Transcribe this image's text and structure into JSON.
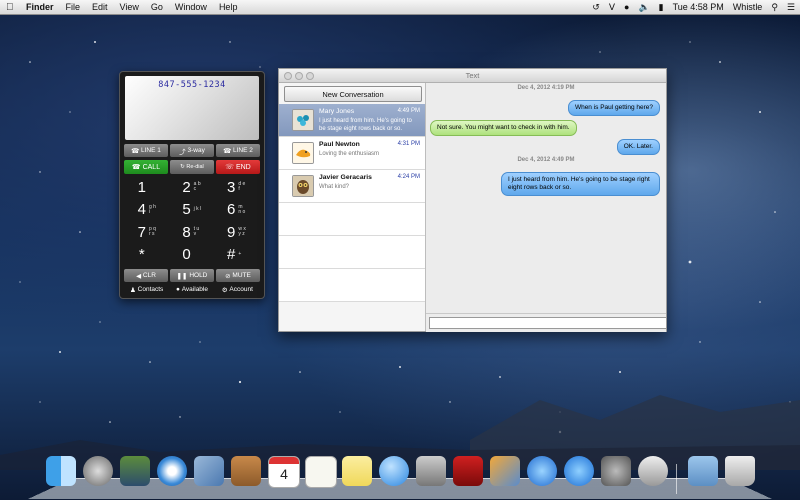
{
  "menubar": {
    "app_name": "Finder",
    "menus": [
      "File",
      "Edit",
      "View",
      "Go",
      "Window",
      "Help"
    ],
    "clock": "Tue 4:58 PM",
    "user": "Whistle"
  },
  "phone": {
    "number": "847-555-1234",
    "line1": "LINE 1",
    "threeway": "3-way",
    "line2": "LINE 2",
    "call": "CALL",
    "redial": "Re-dial",
    "end": "END",
    "keys": [
      {
        "d": "1",
        "s": ""
      },
      {
        "d": "2",
        "s": "a b c"
      },
      {
        "d": "3",
        "s": "d e f"
      },
      {
        "d": "4",
        "s": "g h i"
      },
      {
        "d": "5",
        "s": "j k l"
      },
      {
        "d": "6",
        "s": "m n o"
      },
      {
        "d": "7",
        "s": "p q r s"
      },
      {
        "d": "8",
        "s": "t u v"
      },
      {
        "d": "9",
        "s": "w x y z"
      },
      {
        "d": "*",
        "s": ""
      },
      {
        "d": "0",
        "s": ""
      },
      {
        "d": "#",
        "s": "+"
      }
    ],
    "clr": "CLR",
    "hold": "HOLD",
    "mute": "MUTE",
    "contacts": "Contacts",
    "available": "Available",
    "account": "Account"
  },
  "textwin": {
    "title": "Text",
    "new_conversation": "New Conversation",
    "conversations": [
      {
        "name": "Mary Jones",
        "time": "4:49 PM",
        "preview": "I just heard from him. He's going to be stage eight rows back or so.",
        "selected": true
      },
      {
        "name": "Paul Newton",
        "time": "4:31 PM",
        "preview": "Loving the enthusiasm",
        "selected": false
      },
      {
        "name": "Javier Geracaris",
        "time": "4:24 PM",
        "preview": "What kind?",
        "selected": false
      }
    ],
    "messages": {
      "stamp1": "Dec 4, 2012 4:19 PM",
      "m1": "When is Paul getting here?",
      "m2": "Not sure. You might want to check in with him.",
      "m3": "OK. Later.",
      "stamp2": "Dec 4, 2012 4:49 PM",
      "m4": "I just heard from him. He's going to be stage right eight rows back or so."
    },
    "compose_value": ""
  },
  "dock": {
    "apps": [
      "finder-icon",
      "launchpad-icon",
      "mission-control-icon",
      "safari-icon",
      "mail-icon",
      "contacts-icon",
      "calendar-icon",
      "reminders-icon",
      "notes-icon",
      "messages-icon",
      "facetime-icon",
      "photo-booth-icon",
      "iphoto-icon",
      "itunes-icon",
      "app-store-icon",
      "system-preferences-icon",
      "whistle-icon",
      "downloads-icon",
      "trash-icon"
    ],
    "calendar_day": "4"
  }
}
